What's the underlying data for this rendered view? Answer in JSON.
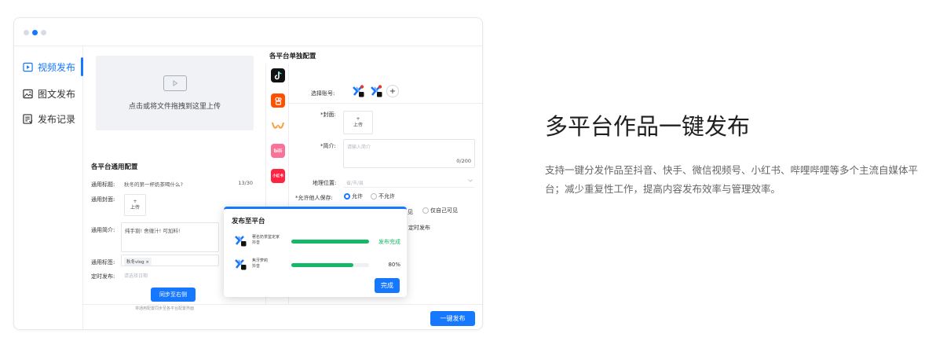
{
  "sidebar": {
    "items": [
      {
        "label": "视频发布",
        "icon": "video-icon"
      },
      {
        "label": "图文发布",
        "icon": "image-icon"
      },
      {
        "label": "发布记录",
        "icon": "record-icon"
      }
    ]
  },
  "upload": {
    "text": "点击或将文件拖拽到这里上传"
  },
  "common": {
    "title": "各平台通用配置",
    "title_label": "通用标题:",
    "title_value": "秋冬的第一杯奶茶喝什么?",
    "title_count": "13/30",
    "cover_label": "通用封面:",
    "cover_plus": "+",
    "cover_text": "上传",
    "intro_label": "通用简介:",
    "intro_value": "纯手割! 舍缠汁! 可加料!",
    "tag_label": "通用标签:",
    "tag_value": "秋冬vlog ×",
    "schedule_label": "定时发布:",
    "schedule_placeholder": "请选择日期",
    "sync_button": "同步至右侧",
    "sync_hint": "将通用配置同步至各平台配置界面"
  },
  "platform": {
    "title": "各平台单独配置",
    "icons": [
      {
        "name": "douyin",
        "color": "#111111",
        "glyph": "♪"
      },
      {
        "name": "kuaishou",
        "color": "#ff5000",
        "glyph": "8"
      },
      {
        "name": "wechat-channels",
        "color": "#ffffff",
        "glyph": "∞"
      },
      {
        "name": "bilibili",
        "color": "#fb7299",
        "glyph": "bili"
      },
      {
        "name": "xiaohongshu",
        "color": "#ff2442",
        "glyph": "小红书"
      }
    ],
    "account_label": "选择账号:",
    "account_add": "+",
    "cover_label": "*封面:",
    "cover_plus": "+",
    "cover_text": "上传",
    "intro_label": "*简介:",
    "intro_placeholder": "请输入简介",
    "intro_count": "0/200",
    "location_label": "地理位置:",
    "location_placeholder": "省/市/县",
    "save_label": "*允许他人保存:",
    "save_allow": "允许",
    "save_deny": "不允许",
    "visibility_partial": "见",
    "visibility_self": "仅自己可见",
    "schedule_partial": "定时发布"
  },
  "modal": {
    "title": "发布至平台",
    "rows": [
      {
        "name": "著名奶茶鉴定家",
        "platform": "抖音",
        "progress": 100,
        "status": "发布完成",
        "status_color": "#14b866"
      },
      {
        "name": "焦牙萝莉",
        "platform": "抖音",
        "progress": 80,
        "status": "80%",
        "status_color": "#333333"
      }
    ],
    "done_button": "完成"
  },
  "publish_button": "一键发布",
  "hero": {
    "heading": "多平台作品一键发布",
    "description": "支持一键分发作品至抖音、快手、微信视频号、小红书、哔哩哔哩等多个主流自媒体平台；减少重复性工作，提高内容发布效率与管理效率。"
  },
  "colors": {
    "accent": "#1677ff",
    "success": "#14b866"
  }
}
